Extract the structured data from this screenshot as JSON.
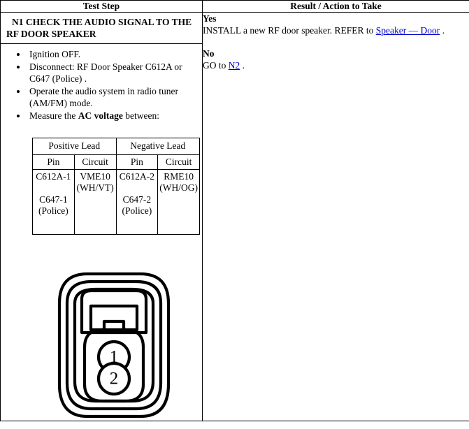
{
  "table": {
    "headers": {
      "test_step": "Test Step",
      "result_action": "Result / Action to Take"
    }
  },
  "step": {
    "title": "N1 CHECK THE AUDIO SIGNAL TO THE RF DOOR SPEAKER",
    "bullets": [
      {
        "text": "Ignition OFF."
      },
      {
        "text": "Disconnect: RF Door Speaker C612A or C647 (Police) ."
      },
      {
        "text": "Operate the audio system in radio tuner (AM/FM) mode."
      },
      {
        "pre": "Measure the ",
        "bold": "AC voltage",
        "post": " between:"
      }
    ]
  },
  "pin_table": {
    "lead_headers": [
      "Positive Lead",
      "Negative Lead"
    ],
    "sub_headers": [
      "Pin",
      "Circuit",
      "Pin",
      "Circuit"
    ],
    "rows": [
      {
        "pos_pin_primary": "C612A-1",
        "pos_pin_alt": "C647-1 (Police)",
        "pos_circuit": "VME10 (WH/VT)",
        "neg_pin_primary": "C612A-2",
        "neg_pin_alt": "C647-2 (Police)",
        "neg_circuit": "RME10 (WH/OG)"
      }
    ]
  },
  "connector": {
    "name": "2-way electrical connector face view",
    "pins": [
      "1",
      "2"
    ]
  },
  "result": {
    "yes_label": "Yes",
    "yes_text_pre": "INSTALL a new RF door speaker. REFER to ",
    "yes_link": "Speaker — Door",
    "yes_text_post": " .",
    "no_label": "No",
    "no_text_pre": "GO to ",
    "no_link": "N2",
    "no_text_post": " ."
  },
  "colors": {
    "link": "#0000CC",
    "border": "#000000",
    "text": "#000000",
    "background": "#FFFFFF"
  }
}
